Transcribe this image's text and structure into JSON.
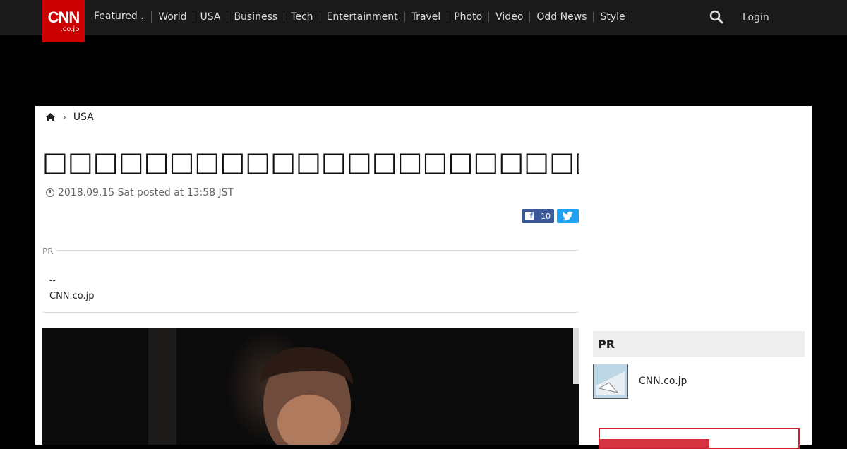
{
  "header": {
    "logo_main": "CNN",
    "logo_sub": ".co.jp",
    "nav": [
      {
        "label": "Featured",
        "has_dropdown": true
      },
      {
        "label": "World"
      },
      {
        "label": "USA"
      },
      {
        "label": "Business"
      },
      {
        "label": "Tech"
      },
      {
        "label": "Entertainment"
      },
      {
        "label": "Travel"
      },
      {
        "label": "Photo"
      },
      {
        "label": "Video"
      },
      {
        "label": "Odd News"
      },
      {
        "label": "Style"
      }
    ],
    "search_icon": "search-icon",
    "login_label": "Login"
  },
  "breadcrumb": {
    "home_icon": "home-icon",
    "section": "USA"
  },
  "article": {
    "headline": "□□□□□□□□□□□□□□□□□□□□□□□□□□□□□□□□□□□□□□□",
    "date_text": "2018.09.15 Sat posted at 13:58 JST",
    "fb_count": "10",
    "pr_label": "PR",
    "pr_dash": "--",
    "pr_link": "CNN.co.jp"
  },
  "sidebar": {
    "pr_heading": "PR",
    "pr_item_label": "CNN.co.jp"
  },
  "colors": {
    "brand_red": "#cc0000",
    "facebook": "#3b5998",
    "twitter": "#1da1f2",
    "nav_bg": "#1a1a1a"
  }
}
